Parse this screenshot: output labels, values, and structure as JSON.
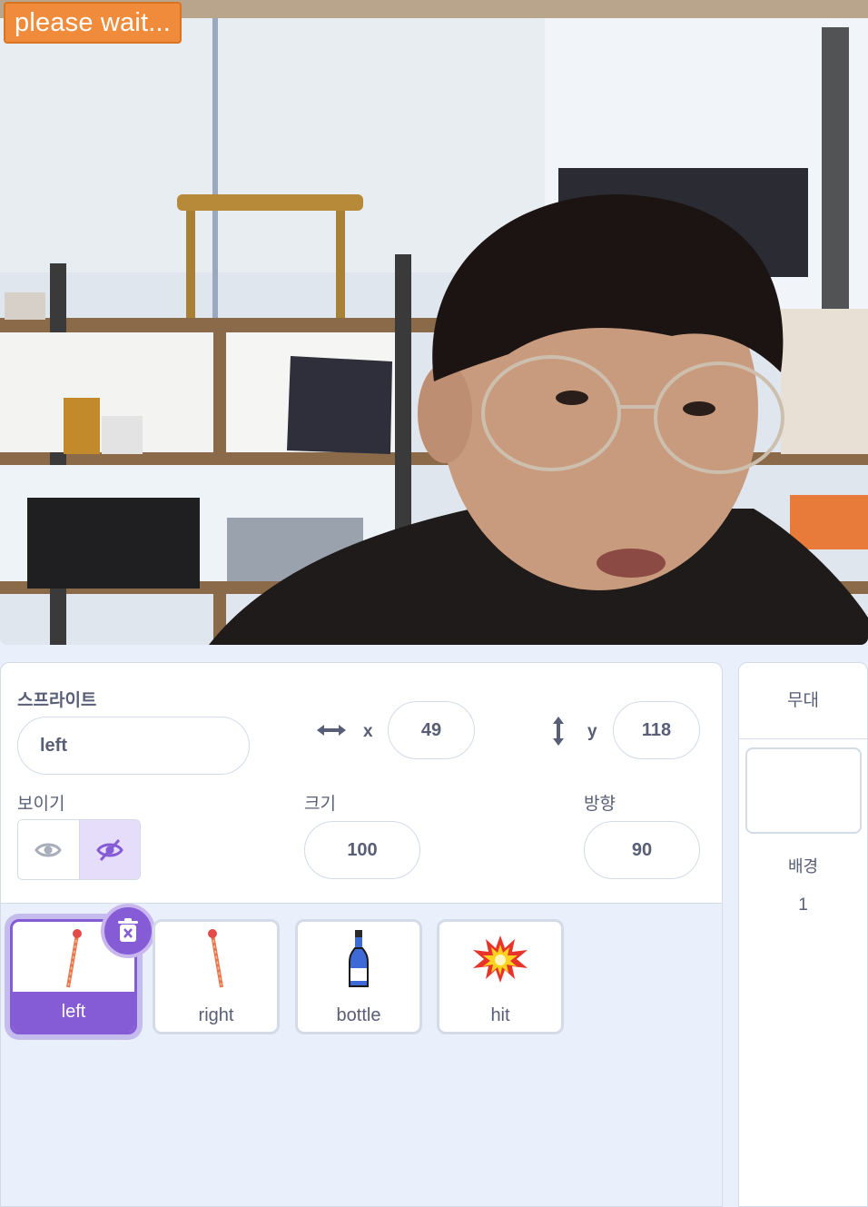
{
  "stage": {
    "status_badge": "please wait..."
  },
  "sprite_info": {
    "sprite_label": "스프라이트",
    "sprite_name": "left",
    "x_label": "x",
    "x_value": "49",
    "y_label": "y",
    "y_value": "118",
    "show_label": "보이기",
    "size_label": "크기",
    "size_value": "100",
    "direction_label": "방향",
    "direction_value": "90",
    "visibility": "hidden"
  },
  "sprites": [
    {
      "name": "left",
      "icon": "stick-icon",
      "selected": true
    },
    {
      "name": "right",
      "icon": "stick-icon",
      "selected": false
    },
    {
      "name": "bottle",
      "icon": "bottle-icon",
      "selected": false
    },
    {
      "name": "hit",
      "icon": "explosion-icon",
      "selected": false
    }
  ],
  "stage_target": {
    "title": "무대",
    "backdrops_label": "배경",
    "backdrops_count": "1"
  },
  "colors": {
    "accent": "#855cd6",
    "badge": "#ef8b3a",
    "border": "#d3dbe8",
    "background": "#e9f0fb"
  }
}
